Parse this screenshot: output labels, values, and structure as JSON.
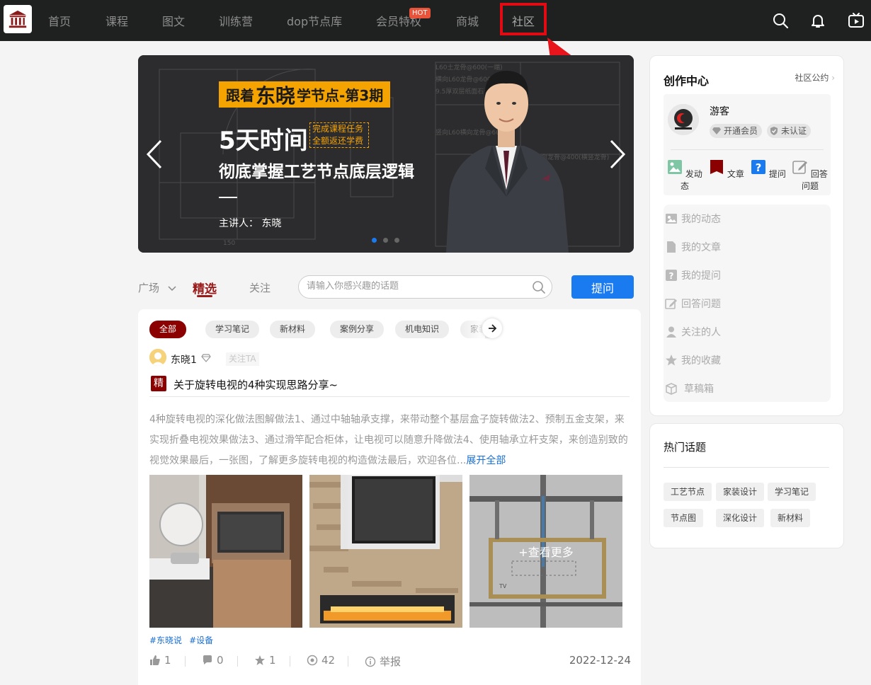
{
  "nav": {
    "items": [
      "首页",
      "课程",
      "图文",
      "训练营",
      "dop节点库",
      "会员特权",
      "商城",
      "社区"
    ],
    "hot_badge": "HOT",
    "active": "社区"
  },
  "banner": {
    "tag_prefix": "跟着",
    "tag_name": "东晓",
    "tag_suffix": "学节点-第3期",
    "days": "5天时间",
    "box_line1": "完成课程任务",
    "box_line2": "全额返还学费",
    "subtitle": "彻底掌握工艺节点底层逻辑",
    "lecturer": "主讲人： 东晓",
    "slides": 3,
    "active_slide": 1
  },
  "tabs": {
    "plaza": "广场",
    "featured": "精选",
    "follow": "关注"
  },
  "search": {
    "placeholder": "请输入你感兴趣的话题"
  },
  "ask_button": "提问",
  "categories": [
    "全部",
    "学习笔记",
    "新材料",
    "案例分享",
    "机电知识",
    "家装"
  ],
  "post": {
    "author": "东晓1",
    "follow_label": "关注TA",
    "badge": "精",
    "title": "关于旋转电视的4种实现思路分享~",
    "body": "4种旋转电视的深化做法图解做法1、通过中轴轴承支撑，来带动整个基层盒子旋转做法2、预制五金支架，来实现折叠电视效果做法3、通过滑竿配合柜体，让电视可以随意升降做法4、使用轴承立杆支架，来创造别致的视觉效果最后，一张图，了解更多旋转电视的构造做法最后，欢迎各位...",
    "expand": "展开全部",
    "more_overlay": "+查看更多",
    "tags": [
      "#东晓说",
      "#设备"
    ],
    "likes": "1",
    "comments": "0",
    "stars": "1",
    "views": "42",
    "report": "举报",
    "date": "2022-12-24"
  },
  "create_center": {
    "title": "创作中心",
    "rules": "社区公约",
    "user_name": "游客",
    "badge_vip": "开通会员",
    "badge_cert": "未认证",
    "actions": [
      "发动态",
      "文章",
      "提问",
      "回答问题"
    ],
    "menu": [
      "我的动态",
      "我的文章",
      "我的提问",
      "回答问题",
      "关注的人",
      "我的收藏",
      "草稿箱"
    ]
  },
  "hot_topics": {
    "title": "热门话题",
    "items": [
      "工艺节点",
      "家装设计",
      "学习笔记",
      "节点图",
      "深化设计",
      "新材料"
    ]
  },
  "colors": {
    "nav_bg": "#1f2121",
    "accent_red": "#8b0000",
    "primary_blue": "#1a7af0",
    "highlight_red": "#e30b13",
    "banner_orange": "#f5a300"
  }
}
